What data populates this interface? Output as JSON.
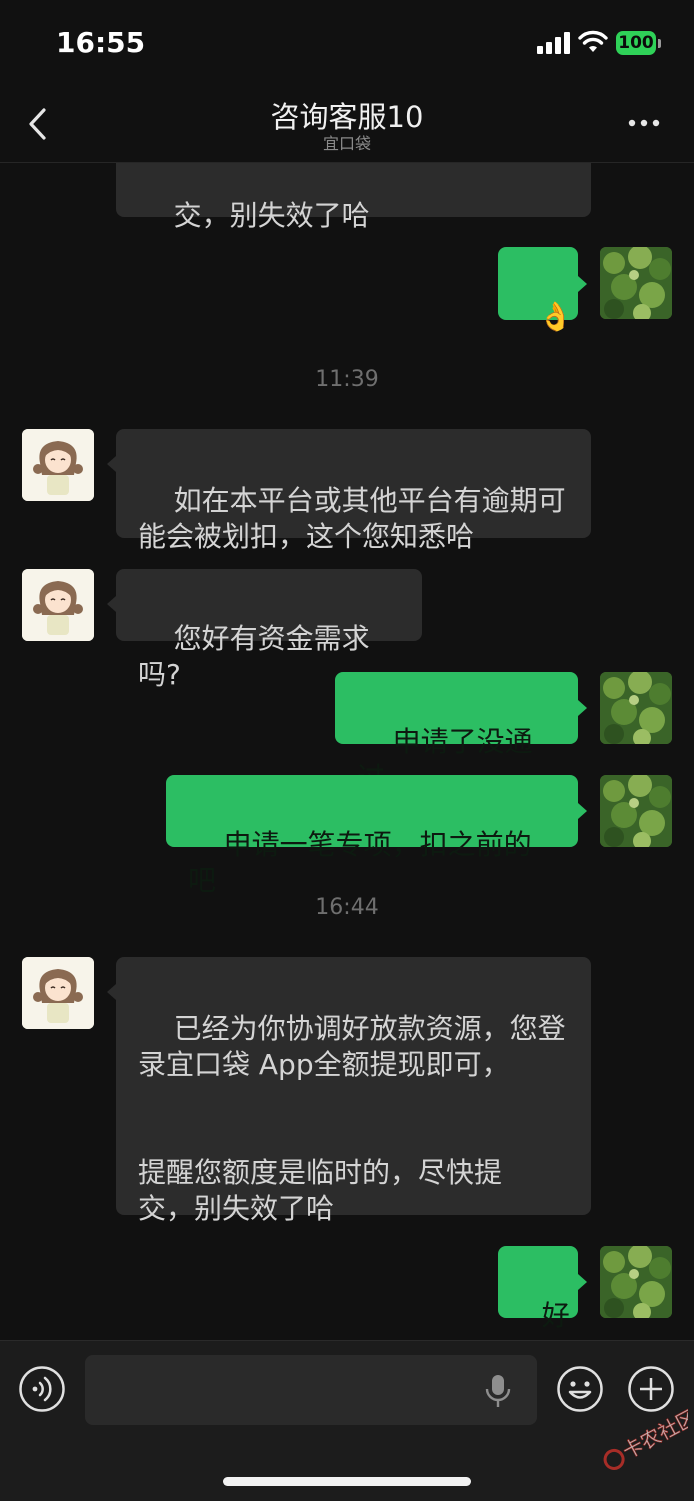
{
  "status_bar": {
    "time": "16:55",
    "battery": "100"
  },
  "header": {
    "title": "咨询客服10",
    "subtitle": "宜口袋"
  },
  "messages": {
    "m0": "交，别失效了哈",
    "m1_emoji": "👌",
    "ts1": "11:39",
    "m2": "如在本平台或其他平台有逾期可\n能会被划扣，这个您知悉哈",
    "m3": "您好有资金需求吗?",
    "m4": "申请了没通过。",
    "m5": "申请一笔专项，扣之前的吧",
    "ts2": "16:44",
    "m6": "已经为你协调好放款资源，您登\n录宜口袋 App全额提现即可，\n\n\n提醒您额度是临时的，尽快提\n交，别失效了哈",
    "m7": "好"
  },
  "input_bar": {
    "placeholder": ""
  },
  "watermark": {
    "text": "卡农社区"
  },
  "icons": [
    "back-icon",
    "more-icon",
    "voice-icon",
    "mic-icon",
    "emoji-icon",
    "plus-icon"
  ],
  "colors": {
    "bubble_out": "#2cbe63",
    "bubble_in": "#2c2c2c",
    "background": "#111111"
  }
}
